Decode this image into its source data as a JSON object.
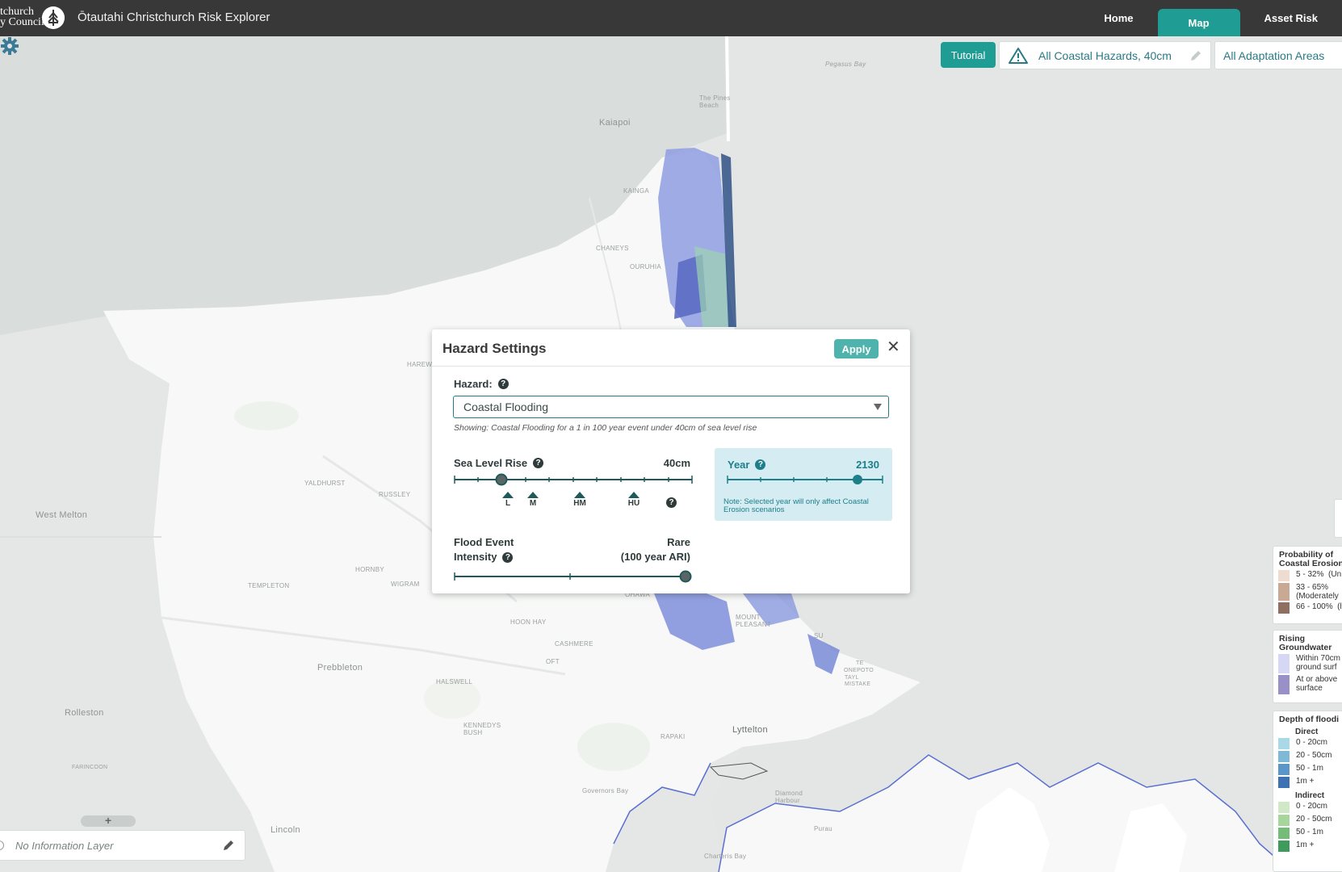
{
  "header": {
    "logo_text": "tchurch\ny Council",
    "app_title": "Ōtautahi Christchurch Risk Explorer",
    "nav": [
      {
        "label": "Home",
        "active": false
      },
      {
        "label": "Map",
        "active": true
      },
      {
        "label": "Asset Risk",
        "active": false
      }
    ]
  },
  "colors": {
    "accent": "#1f9c94",
    "header_bg": "#383838",
    "link_text": "#2a7a85"
  },
  "controls": {
    "tutorial_label": "Tutorial",
    "scenario_label": "All Coastal Hazards, 40cm",
    "adaptation_label": "All Adaptation Areas"
  },
  "map_labels": {
    "pegasus_bay": "Pegasus Bay",
    "the_pines_beach": "The Pines\nBeach",
    "kaiapoi": "Kaiapoi",
    "kainga": "KAINGA",
    "chaneys": "CHANEYS",
    "ouruhia": "OURUHIA",
    "harewood": "HAREW",
    "yaldhurst": "YALDHURST",
    "russley": "RUSSLEY",
    "west_melton": "West Melton",
    "hornby": "HORNBY",
    "templeton": "TEMPLETON",
    "wigram": "WIGRAM",
    "hoon_hay": "HOON HAY",
    "cashmere": "CASHMERE",
    "halswell": "HALSWELL",
    "prebbleton": "Prebbleton",
    "rolleston": "Rolleston",
    "kennedys_bush": "KENNEDYS\nBUSH",
    "lyttelton": "Lyttelton",
    "rapaki": "RAPAKI",
    "governors_bay": "Governors Bay",
    "diamond_harbour": "Diamond\nHarbour",
    "charteris_bay": "Charteris Bay",
    "purau": "Purau",
    "lincoln": "Lincoln",
    "mount_pleasant": "MOUNT\nPLEASANT",
    "taylors_mistake": "TAYL\nMISTAKE",
    "onepoto": "ONEPOTO",
    "ohawa": "OHAWA",
    "sumner": "SU",
    "te": "TE",
    "oft": "OFT",
    "farincoon": "FARINCOON"
  },
  "hazard_settings": {
    "title": "Hazard Settings",
    "apply_label": "Apply",
    "close_symbol": "✕",
    "hazard_label": "Hazard:",
    "hazard_value": "Coastal Flooding",
    "showing_text": "Showing: Coastal Flooding for a 1 in 100 year event under 40cm of sea level rise",
    "sea_level_rise": {
      "label": "Sea Level Rise",
      "value": "40cm",
      "position": 0.2,
      "markers": [
        "L",
        "M",
        "HM",
        "HU"
      ]
    },
    "year": {
      "label": "Year",
      "value": "2130",
      "position": 0.84,
      "note": "Note: Selected year will only affect Coastal Erosion scenarios"
    },
    "flood_event": {
      "label_line1": "Flood Event",
      "label_line2": "Intensity",
      "value_line1": "Rare",
      "value_line2": "(100 year ARI)",
      "position": 1.0
    }
  },
  "info_layer": {
    "label": "No Information Layer",
    "add_symbol": "+"
  },
  "legends": {
    "erosion": {
      "title": "Probability of\nCoastal Erosion",
      "items": [
        {
          "label": "5 - 32%  (Un",
          "color": "#efdcd0"
        },
        {
          "label": "33 - 65%\n(Moderately",
          "color": "#c9a894"
        },
        {
          "label": "66 - 100%  (l",
          "color": "#8f6f60"
        }
      ]
    },
    "groundwater": {
      "title": "Rising\nGroundwater",
      "items": [
        {
          "label": "Within 70cm\nground surf",
          "color": "#d6d6f5"
        },
        {
          "label": "At or above\nsurface",
          "color": "#9a90c8"
        }
      ]
    },
    "flooding": {
      "title": "Depth of floodi",
      "direct_label": "Direct",
      "direct": [
        {
          "label": "0 - 20cm",
          "color": "#a9d8e6"
        },
        {
          "label": "20 - 50cm",
          "color": "#7fb9d8"
        },
        {
          "label": "50 - 1m",
          "color": "#5b96c8"
        },
        {
          "label": "1m +",
          "color": "#3e73b3"
        }
      ],
      "indirect_label": "Indirect",
      "indirect": [
        {
          "label": "0 - 20cm",
          "color": "#cfe9c6"
        },
        {
          "label": "20 - 50cm",
          "color": "#a6d69b"
        },
        {
          "label": "50 - 1m",
          "color": "#74bd79"
        },
        {
          "label": "1m +",
          "color": "#3f9a5c"
        }
      ]
    }
  }
}
